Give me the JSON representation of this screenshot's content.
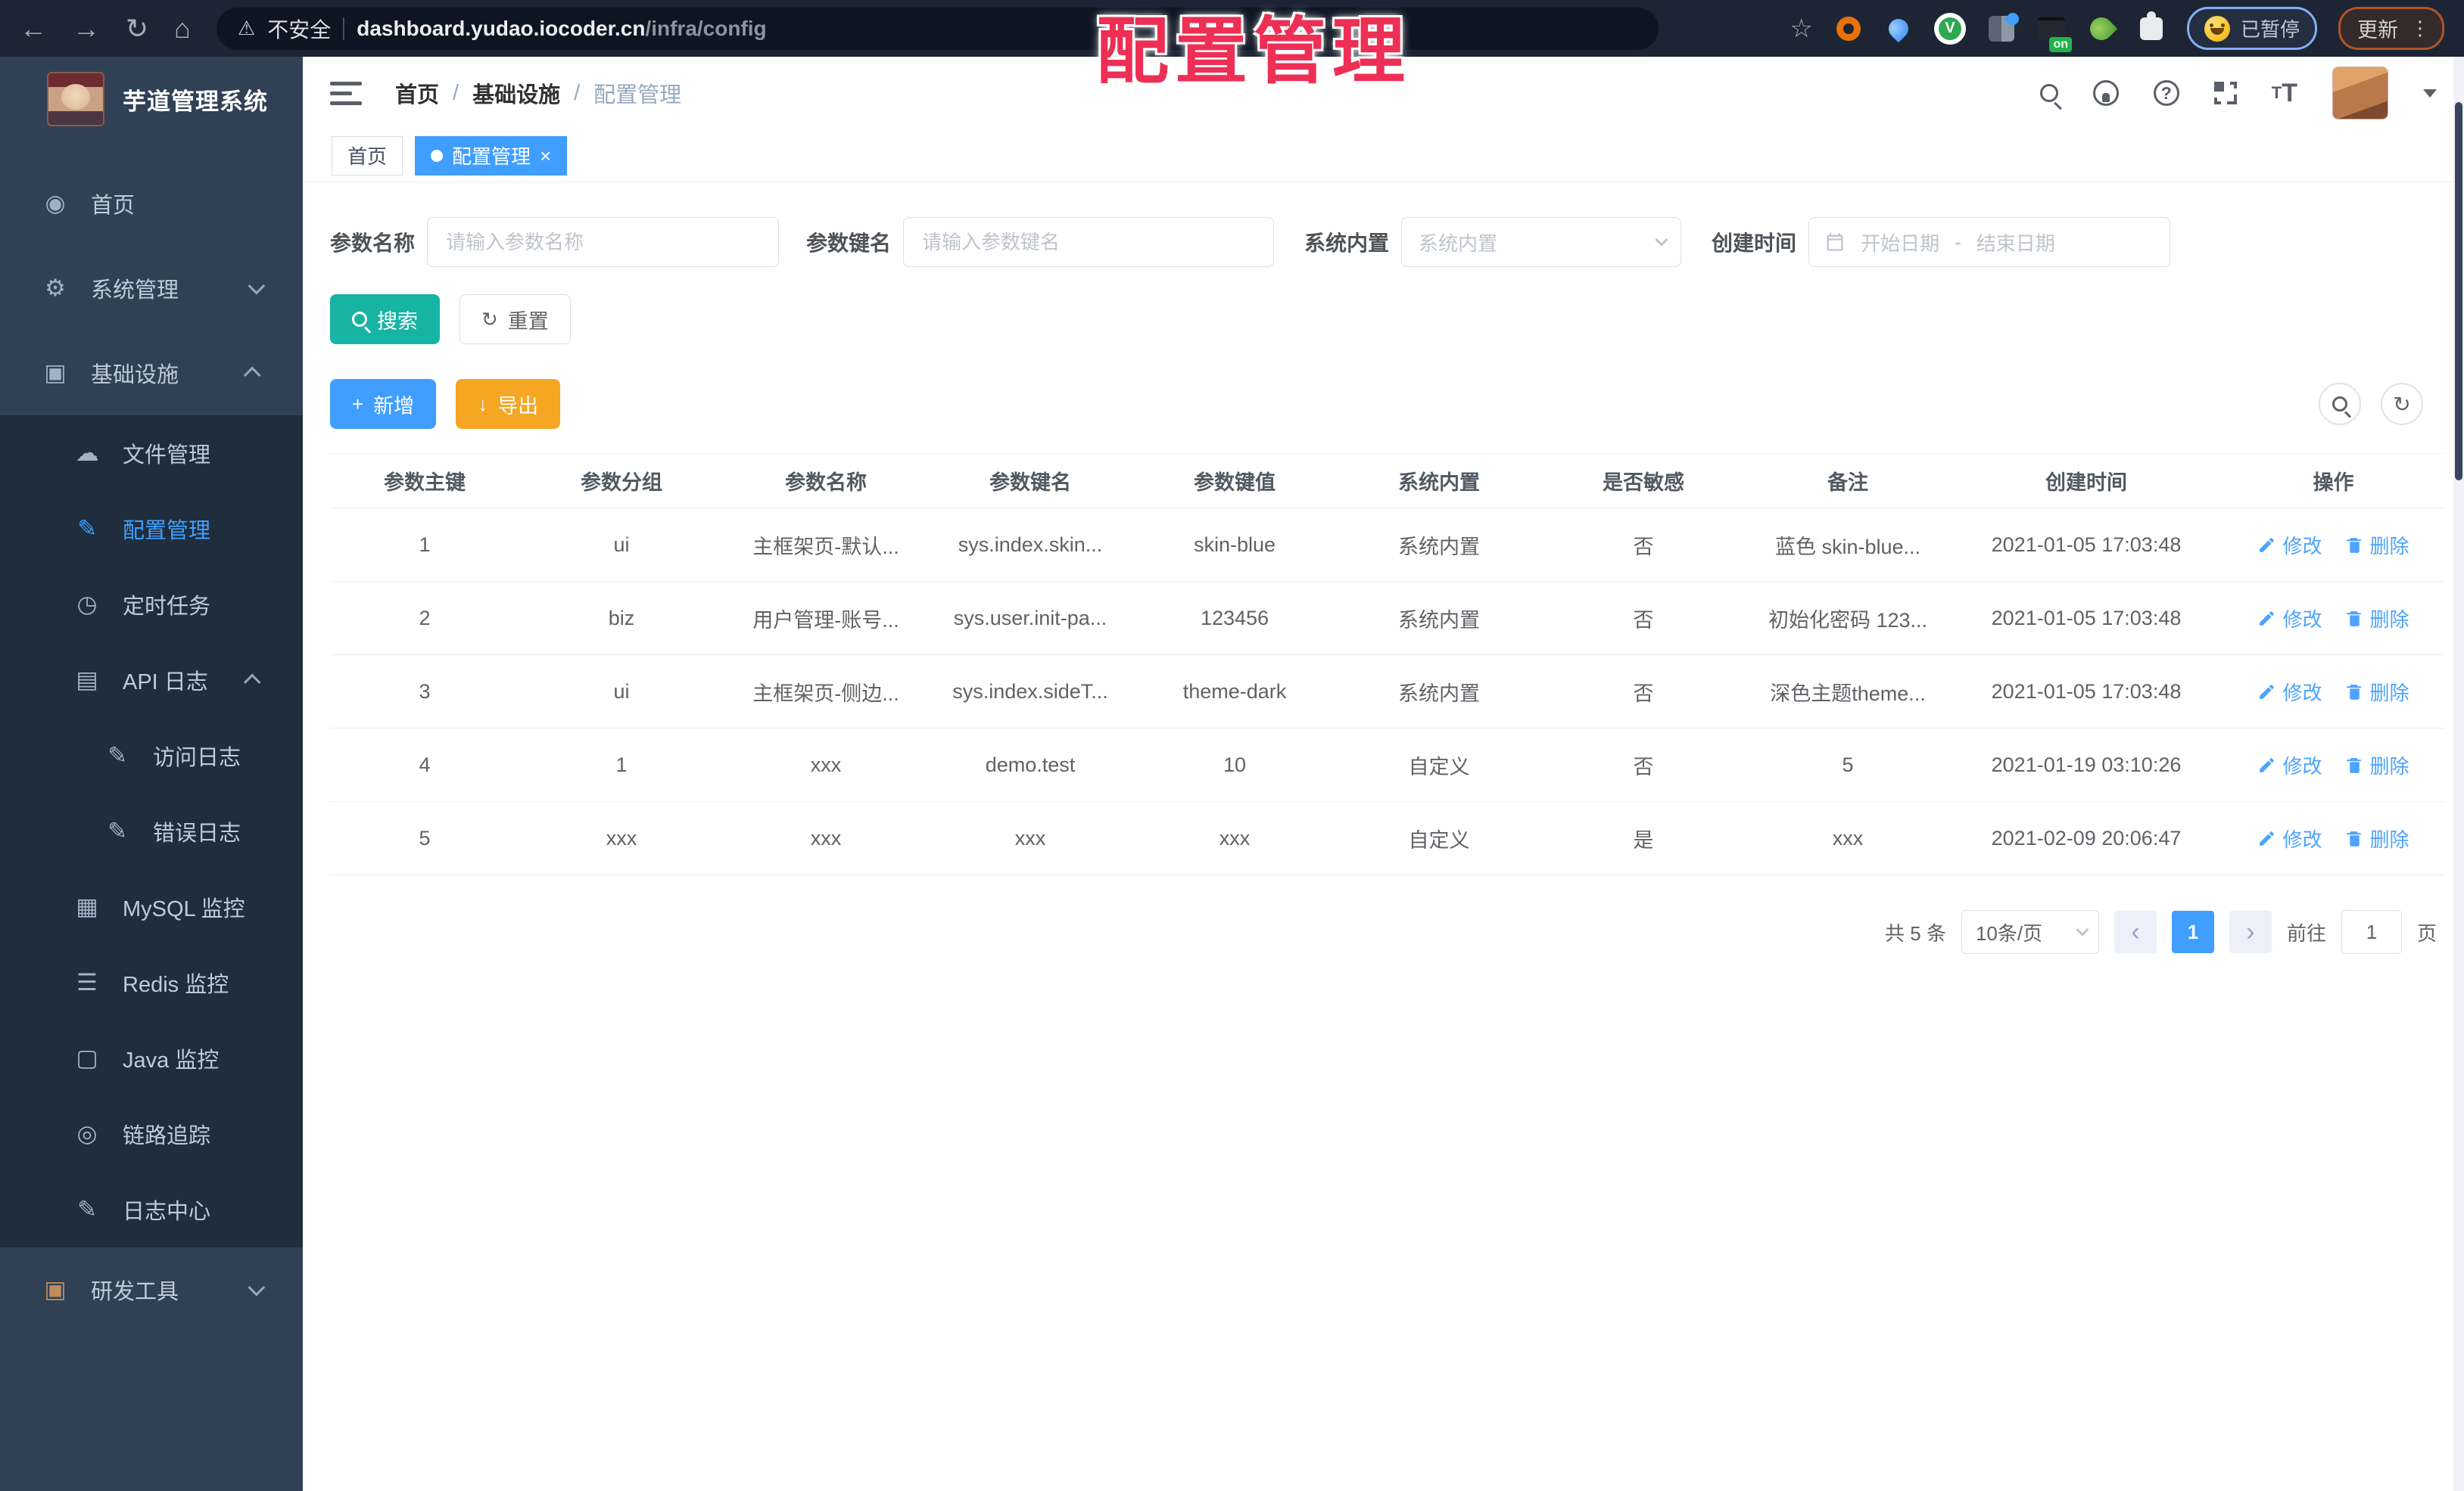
{
  "browser": {
    "security_label": "不安全",
    "url_domain": "dashboard.yudao.iocoder.cn",
    "url_path": "/infra/config",
    "paused_label": "已暂停",
    "update_label": "更新",
    "extension_on_label": "on",
    "vue_ext_letter": "V"
  },
  "icons": {
    "back": "←",
    "forward": "→",
    "reload": "↻",
    "home": "⌂",
    "warning": "⚠",
    "star": "☆",
    "dots": "⋮",
    "help": "?",
    "close": "×",
    "plus": "+",
    "download": "↓",
    "refresh": "↻",
    "prev": "‹",
    "next": "›",
    "t_small": "T",
    "t_big": "T"
  },
  "annotation": {
    "title": "配置管理"
  },
  "sidebar": {
    "app_title": "芋道管理系统",
    "items": [
      {
        "name": "home",
        "label": "首页",
        "icon": "dashboard-icon",
        "glyph": "◉",
        "level": 0
      },
      {
        "name": "system",
        "label": "系统管理",
        "icon": "gear-icon",
        "glyph": "⚙",
        "level": 0,
        "chevron": "down"
      },
      {
        "name": "infrastructure",
        "label": "基础设施",
        "icon": "chart-box-icon",
        "glyph": "▣",
        "level": 0,
        "chevron": "up"
      },
      {
        "name": "file-manage",
        "label": "文件管理",
        "icon": "cloud-upload-icon",
        "glyph": "☁",
        "level": 1,
        "dark": true
      },
      {
        "name": "config-manage",
        "label": "配置管理",
        "icon": "edit-square-icon",
        "glyph": "✎",
        "level": 1,
        "dark": true,
        "active": true
      },
      {
        "name": "scheduled-jobs",
        "label": "定时任务",
        "icon": "timer-icon",
        "glyph": "◷",
        "level": 1,
        "dark": true
      },
      {
        "name": "api-log",
        "label": "API 日志",
        "icon": "log-icon",
        "glyph": "▤",
        "level": 1,
        "dark": true,
        "chevron": "up"
      },
      {
        "name": "access-log",
        "label": "访问日志",
        "icon": "doc-edit-icon",
        "glyph": "✎",
        "level": 2,
        "dark": true
      },
      {
        "name": "error-log",
        "label": "错误日志",
        "icon": "doc-edit-icon",
        "glyph": "✎",
        "level": 2,
        "dark": true
      },
      {
        "name": "mysql-monitor",
        "label": "MySQL 监控",
        "icon": "database-icon",
        "glyph": "▦",
        "level": 1,
        "dark": true
      },
      {
        "name": "redis-monitor",
        "label": "Redis 监控",
        "icon": "layers-icon",
        "glyph": "☰",
        "level": 1,
        "dark": true
      },
      {
        "name": "java-monitor",
        "label": "Java 监控",
        "icon": "monitor-icon",
        "glyph": "▢",
        "level": 1,
        "dark": true
      },
      {
        "name": "trace",
        "label": "链路追踪",
        "icon": "eye-icon",
        "glyph": "◎",
        "level": 1,
        "dark": true
      },
      {
        "name": "log-center",
        "label": "日志中心",
        "icon": "edit-icon",
        "glyph": "✎",
        "level": 1,
        "dark": true
      },
      {
        "name": "dev-tools",
        "label": "研发工具",
        "icon": "toolbox-icon",
        "glyph": "▣",
        "level": 0,
        "chevron": "down"
      }
    ]
  },
  "navbar": {
    "breadcrumb": [
      {
        "label": "首页"
      },
      {
        "label": "基础设施"
      },
      {
        "label": "配置管理",
        "current": true
      }
    ],
    "separator": "/"
  },
  "tabs": [
    {
      "label": "首页"
    },
    {
      "label": "配置管理",
      "active": true,
      "closable": true
    }
  ],
  "filters": {
    "name_label": "参数名称",
    "name_placeholder": "请输入参数名称",
    "key_label": "参数键名",
    "key_placeholder": "请输入参数键名",
    "type_label": "系统内置",
    "type_placeholder": "系统内置",
    "date_label": "创建时间",
    "date_start_placeholder": "开始日期",
    "date_separator": "-",
    "date_end_placeholder": "结束日期",
    "search_button": "搜索",
    "reset_button": "重置",
    "add_button": "新增",
    "export_button": "导出"
  },
  "table": {
    "columns": [
      "参数主键",
      "参数分组",
      "参数名称",
      "参数键名",
      "参数键值",
      "系统内置",
      "是否敏感",
      "备注",
      "创建时间",
      "操作"
    ],
    "rows": [
      {
        "cells": [
          "1",
          "ui",
          "主框架页-默认...",
          "sys.index.skin...",
          "skin-blue",
          "系统内置",
          "否",
          "蓝色 skin-blue...",
          "2021-01-05 17:03:48"
        ]
      },
      {
        "cells": [
          "2",
          "biz",
          "用户管理-账号...",
          "sys.user.init-pa...",
          "123456",
          "系统内置",
          "否",
          "初始化密码 123...",
          "2021-01-05 17:03:48"
        ]
      },
      {
        "cells": [
          "3",
          "ui",
          "主框架页-侧边...",
          "sys.index.sideT...",
          "theme-dark",
          "系统内置",
          "否",
          "深色主题theme...",
          "2021-01-05 17:03:48"
        ]
      },
      {
        "cells": [
          "4",
          "1",
          "xxx",
          "demo.test",
          "10",
          "自定义",
          "否",
          "5",
          "2021-01-19 03:10:26"
        ]
      },
      {
        "cells": [
          "5",
          "xxx",
          "xxx",
          "xxx",
          "xxx",
          "自定义",
          "是",
          "xxx",
          "2021-02-09 20:06:47"
        ]
      }
    ],
    "edit_label": "修改",
    "delete_label": "删除"
  },
  "pagination": {
    "total_label": "共 5 条",
    "page_size_label": "10条/页",
    "current_page": "1",
    "goto_label": "前往",
    "goto_value": "1",
    "unit_label": "页"
  },
  "colors": {
    "primary": "#409EFF",
    "search_teal": "#17b3a3",
    "export_orange": "#f5a623",
    "sidebar_bg": "#304156",
    "submenu_bg": "#1f2d3d",
    "annotation_red": "#ee2f55",
    "chrome_bg": "#1d2534"
  }
}
